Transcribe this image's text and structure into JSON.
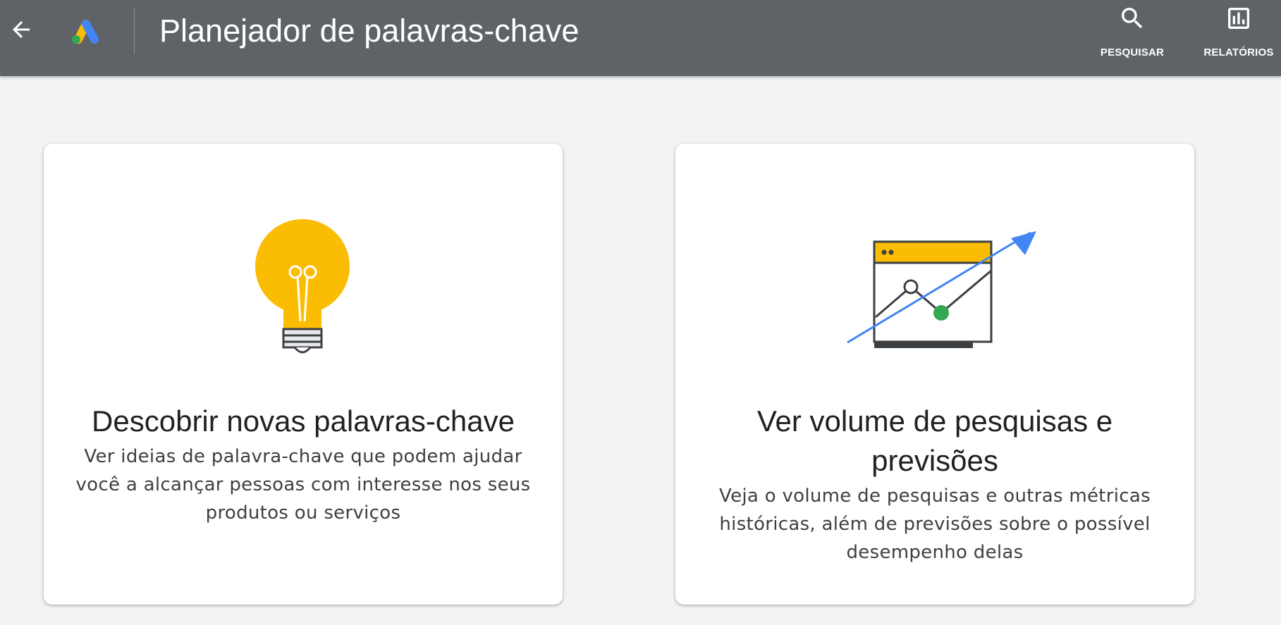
{
  "header": {
    "back_icon": "arrow-back-icon",
    "logo": "google-ads-logo",
    "title": "Planejador de palavras-chave",
    "background_color": "#5f6368",
    "actions": [
      {
        "icon": "search-icon",
        "label": "PESQUISAR"
      },
      {
        "icon": "bar-chart-icon",
        "label": "RELATÓRIOS"
      }
    ]
  },
  "cards": [
    {
      "illustration": "lightbulb-icon",
      "title": "Descobrir novas palavras-chave",
      "description": "Ver ideias de palavra-chave que podem ajudar você a alcançar pessoas com interesse nos seus produtos ou serviços"
    },
    {
      "illustration": "chart-trend-up-icon",
      "title": "Ver volume de pesquisas e previsões",
      "description": "Veja o volume de pesquisas e outras métricas históricas, além de previsões sobre o possível desempenho delas"
    }
  ],
  "colors": {
    "page_background": "#f1f3f4",
    "accent_yellow": "#fbbc04",
    "accent_blue": "#4285f4",
    "accent_green": "#34a853"
  }
}
